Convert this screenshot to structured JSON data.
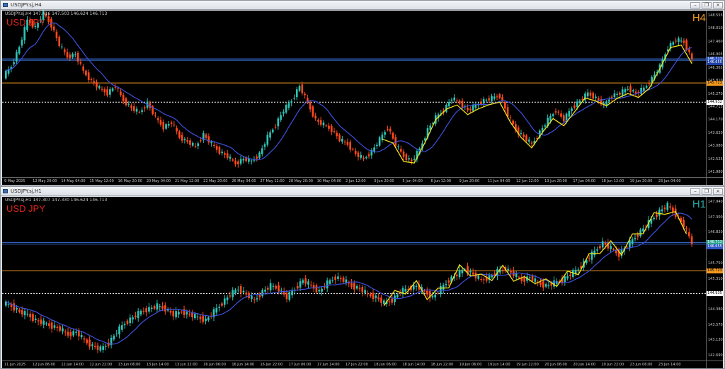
{
  "colors": {
    "bull": "#2ec4b6",
    "bear": "#ff4a1c",
    "ma": "#3f51e0",
    "zigzag": "#f2e21b",
    "orange_line": "#f39a1e",
    "white_line": "#ffffff",
    "blue_line": "#3a6fd8"
  },
  "panels": [
    {
      "window_title": "USDJPY.sj,H4",
      "info_line": "USDJPY.sj,H4  147.416 147.503 146.624 146.713",
      "symbol_label": "USD JPY",
      "timeframe_label": "H4",
      "timeframe_color": "#f39a1e",
      "axis_ticks": [
        "148.555",
        "148.010",
        "147.460",
        "146.905",
        "146.365",
        "145.810",
        "145.270",
        "144.715",
        "144.170",
        "143.620",
        "143.080",
        "142.525",
        "141.980"
      ],
      "level_badges": [
        {
          "text": "146.713",
          "color": "#2e56c8"
        },
        {
          "text": "146.655",
          "color": "#1d3ea6"
        },
        {
          "text": "145.723",
          "color": "#f39a1e"
        },
        {
          "text": "144.932",
          "color": "#ffffff"
        }
      ],
      "time_ticks": [
        "9 May 2025",
        "12 May 20:00",
        "14 May 04:00",
        "15 May 12:00",
        "16 May 20:00",
        "20 May 04:00",
        "21 May 12:00",
        "22 May 20:00",
        "26 May 04:00",
        "27 May 12:00",
        "28 May 20:00",
        "30 May 04:00",
        "2 Jun 12:00",
        "3 Jun 20:00",
        "5 Jun 04:00",
        "6 Jun 12:00",
        "9 Jun 20:00",
        "11 Jun 04:00",
        "12 Jun 12:00",
        "13 Jun 20:00",
        "17 Jun 04:00",
        "18 Jun 12:00",
        "19 Jun 20:00",
        "23 Jun 04:00"
      ],
      "chart_data": {
        "type": "candlestick",
        "ylim": [
          141.85,
          148.7
        ],
        "moving_average": "blue",
        "horizontal_lines": [
          146.713,
          146.655,
          145.723,
          144.932
        ],
        "path": [
          146.0,
          146.4,
          147.2,
          148.3,
          148.0,
          148.6,
          148.1,
          147.3,
          146.8,
          146.9,
          146.2,
          145.8,
          145.5,
          145.3,
          145.6,
          145.0,
          144.7,
          144.5,
          144.9,
          144.3,
          143.9,
          144.1,
          143.5,
          143.3,
          143.1,
          143.6,
          143.2,
          142.9,
          142.7,
          142.4,
          142.6,
          142.5,
          142.8,
          143.5,
          144.0,
          144.6,
          145.0,
          145.6,
          144.9,
          144.2,
          144.0,
          143.8,
          143.4,
          143.2,
          142.8,
          142.6,
          142.9,
          143.4,
          143.9,
          143.2,
          142.7,
          142.5,
          143.0,
          143.8,
          144.3,
          144.6,
          145.1,
          144.9,
          144.6,
          144.8,
          145.0,
          145.1,
          145.2,
          144.4,
          143.8,
          143.5,
          143.2,
          143.7,
          144.2,
          144.6,
          144.2,
          144.7,
          145.0,
          145.3,
          145.1,
          144.8,
          145.2,
          145.3,
          145.5,
          145.3,
          145.5,
          145.9,
          146.4,
          147.2,
          147.5,
          147.4,
          146.7
        ]
      }
    },
    {
      "window_title": "USDJPY.sj,H1",
      "info_line": "USDJPY.sj,H1  147.307 147.330 146.624 146.713",
      "symbol_label": "USD JPY",
      "timeframe_label": "H1",
      "timeframe_color": "#2aa5a0",
      "axis_ticks": [
        "147.940",
        "147.300",
        "146.820",
        "146.190",
        "145.750",
        "145.310",
        "144.820",
        "144.380",
        "143.570",
        "143.130",
        "142.690"
      ],
      "level_badges": [
        {
          "text": "146.713",
          "color": "#2aa58f"
        },
        {
          "text": "146.655",
          "color": "#2e56c8"
        },
        {
          "text": "145.723",
          "color": "#f39a1e"
        },
        {
          "text": "144.935",
          "color": "#ffffff"
        }
      ],
      "time_ticks": [
        "11 Jun 2025",
        "12 Jun 06:00",
        "12 Jun 14:00",
        "12 Jun 22:00",
        "13 Jun 06:00",
        "13 Jun 14:00",
        "13 Jun 22:00",
        "16 Jun 06:00",
        "16 Jun 14:00",
        "16 Jun 22:00",
        "17 Jun 06:00",
        "17 Jun 14:00",
        "17 Jun 22:00",
        "18 Jun 06:00",
        "18 Jun 14:00",
        "18 Jun 22:00",
        "19 Jun 06:00",
        "19 Jun 14:00",
        "19 Jun 22:00",
        "20 Jun 06:00",
        "20 Jun 14:00",
        "20 Jun 22:00",
        "23 Jun 06:00",
        "23 Jun 14:00"
      ],
      "chart_data": {
        "type": "candlestick",
        "ylim": [
          142.6,
          148.3
        ],
        "moving_average": "blue",
        "horizontal_lines": [
          146.713,
          146.655,
          145.723,
          144.935
        ],
        "path": [
          144.6,
          144.5,
          144.3,
          144.2,
          144.0,
          143.9,
          143.8,
          143.7,
          143.5,
          143.6,
          143.3,
          143.1,
          143.0,
          143.2,
          143.6,
          143.9,
          144.1,
          144.3,
          144.4,
          144.5,
          144.4,
          144.2,
          144.3,
          144.2,
          144.1,
          144.0,
          144.3,
          144.6,
          144.9,
          145.1,
          144.9,
          144.7,
          145.0,
          145.2,
          145.1,
          144.8,
          145.1,
          145.4,
          145.2,
          145.0,
          145.3,
          145.5,
          145.4,
          145.2,
          145.1,
          144.9,
          144.8,
          144.6,
          144.7,
          145.0,
          145.1,
          145.2,
          145.0,
          144.8,
          145.1,
          145.4,
          145.6,
          145.8,
          145.6,
          145.4,
          145.5,
          145.7,
          145.8,
          145.6,
          145.4,
          145.5,
          145.3,
          145.2,
          145.3,
          145.4,
          145.6,
          145.8,
          146.1,
          146.4,
          146.7,
          146.5,
          146.3,
          146.6,
          146.9,
          147.2,
          147.5,
          147.8,
          148.0,
          147.7,
          147.3,
          146.7
        ]
      }
    }
  ]
}
